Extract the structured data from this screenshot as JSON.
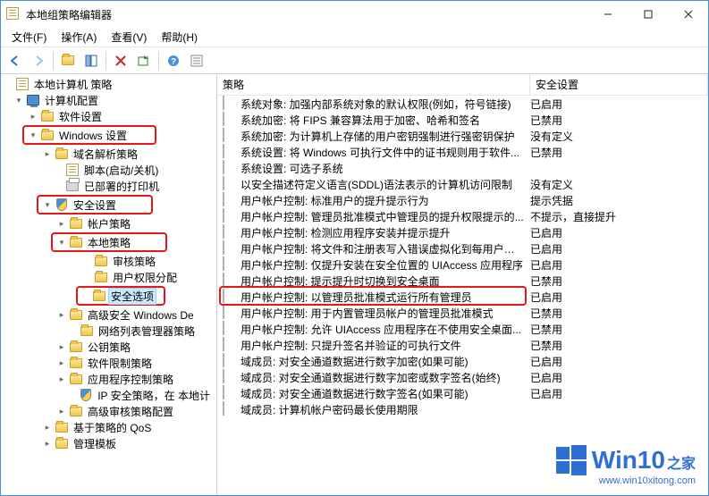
{
  "window": {
    "title": "本地组策略编辑器"
  },
  "menu": {
    "file": "文件(F)",
    "action": "操作(A)",
    "view": "查看(V)",
    "help": "帮助(H)"
  },
  "list_header": {
    "policy": "策略",
    "setting": "安全设置"
  },
  "tree": {
    "root": "本地计算机 策略",
    "computer_config": "计算机配置",
    "software_settings": "软件设置",
    "windows_settings": "Windows 设置",
    "name_resolution": "域名解析策略",
    "scripts": "脚本(启动/关机)",
    "printers": "已部署的打印机",
    "security_settings": "安全设置",
    "account_policies": "帐户策略",
    "local_policies": "本地策略",
    "audit_policy": "审核策略",
    "user_rights": "用户权限分配",
    "security_options": "安全选项",
    "windows_defender": "高级安全 Windows De",
    "network_list": "网络列表管理器策略",
    "public_key": "公钥策略",
    "software_restriction": "软件限制策略",
    "app_control": "应用程序控制策略",
    "ip_security": "IP 安全策略，在 本地计",
    "advanced_audit": "高级审核策略配置",
    "qos": "基于策略的 QoS",
    "admin_templates": "管理模板"
  },
  "policies": [
    {
      "name": "系统对象: 加强内部系统对象的默认权限(例如，符号链接)",
      "setting": "已启用"
    },
    {
      "name": "系统加密: 将 FIPS 兼容算法用于加密、哈希和签名",
      "setting": "已禁用"
    },
    {
      "name": "系统加密: 为计算机上存储的用户密钥强制进行强密钥保护",
      "setting": "没有定义"
    },
    {
      "name": "系统设置: 将 Windows 可执行文件中的证书规则用于软件...",
      "setting": "已禁用"
    },
    {
      "name": "系统设置: 可选子系统",
      "setting": ""
    },
    {
      "name": "以安全描述符定义语言(SDDL)语法表示的计算机访问限制",
      "setting": "没有定义"
    },
    {
      "name": "用户帐户控制: 标准用户的提升提示行为",
      "setting": "提示凭据"
    },
    {
      "name": "用户帐户控制: 管理员批准模式中管理员的提升权限提示的...",
      "setting": "不提示，直接提升"
    },
    {
      "name": "用户帐户控制: 检测应用程序安装并提示提升",
      "setting": "已启用"
    },
    {
      "name": "用户帐户控制: 将文件和注册表写入错误虚拟化到每用户位置",
      "setting": "已启用"
    },
    {
      "name": "用户帐户控制: 仅提升安装在安全位置的 UIAccess 应用程序",
      "setting": "已启用"
    },
    {
      "name": "用户帐户控制: 提示提升时切换到安全桌面",
      "setting": "已禁用"
    },
    {
      "name": "用户帐户控制: 以管理员批准模式运行所有管理员",
      "setting": "已启用"
    },
    {
      "name": "用户帐户控制: 用于内置管理员帐户的管理员批准模式",
      "setting": "已禁用"
    },
    {
      "name": "用户帐户控制: 允许 UIAccess 应用程序在不使用安全桌面...",
      "setting": "已禁用"
    },
    {
      "name": "用户帐户控制: 只提升签名并验证的可执行文件",
      "setting": "已禁用"
    },
    {
      "name": "域成员: 对安全通道数据进行数字加密(如果可能)",
      "setting": "已启用"
    },
    {
      "name": "域成员: 对安全通道数据进行数字加密或数字签名(始终)",
      "setting": "已启用"
    },
    {
      "name": "域成员: 对安全通道数据进行数字签名(如果可能)",
      "setting": "已启用"
    },
    {
      "name": "域成员: 计算机帐户密码最长使用期限",
      "setting": ""
    }
  ],
  "watermark": {
    "brand_main": "Win10",
    "brand_sub": "之家",
    "url": "www.win10xitong.com"
  }
}
